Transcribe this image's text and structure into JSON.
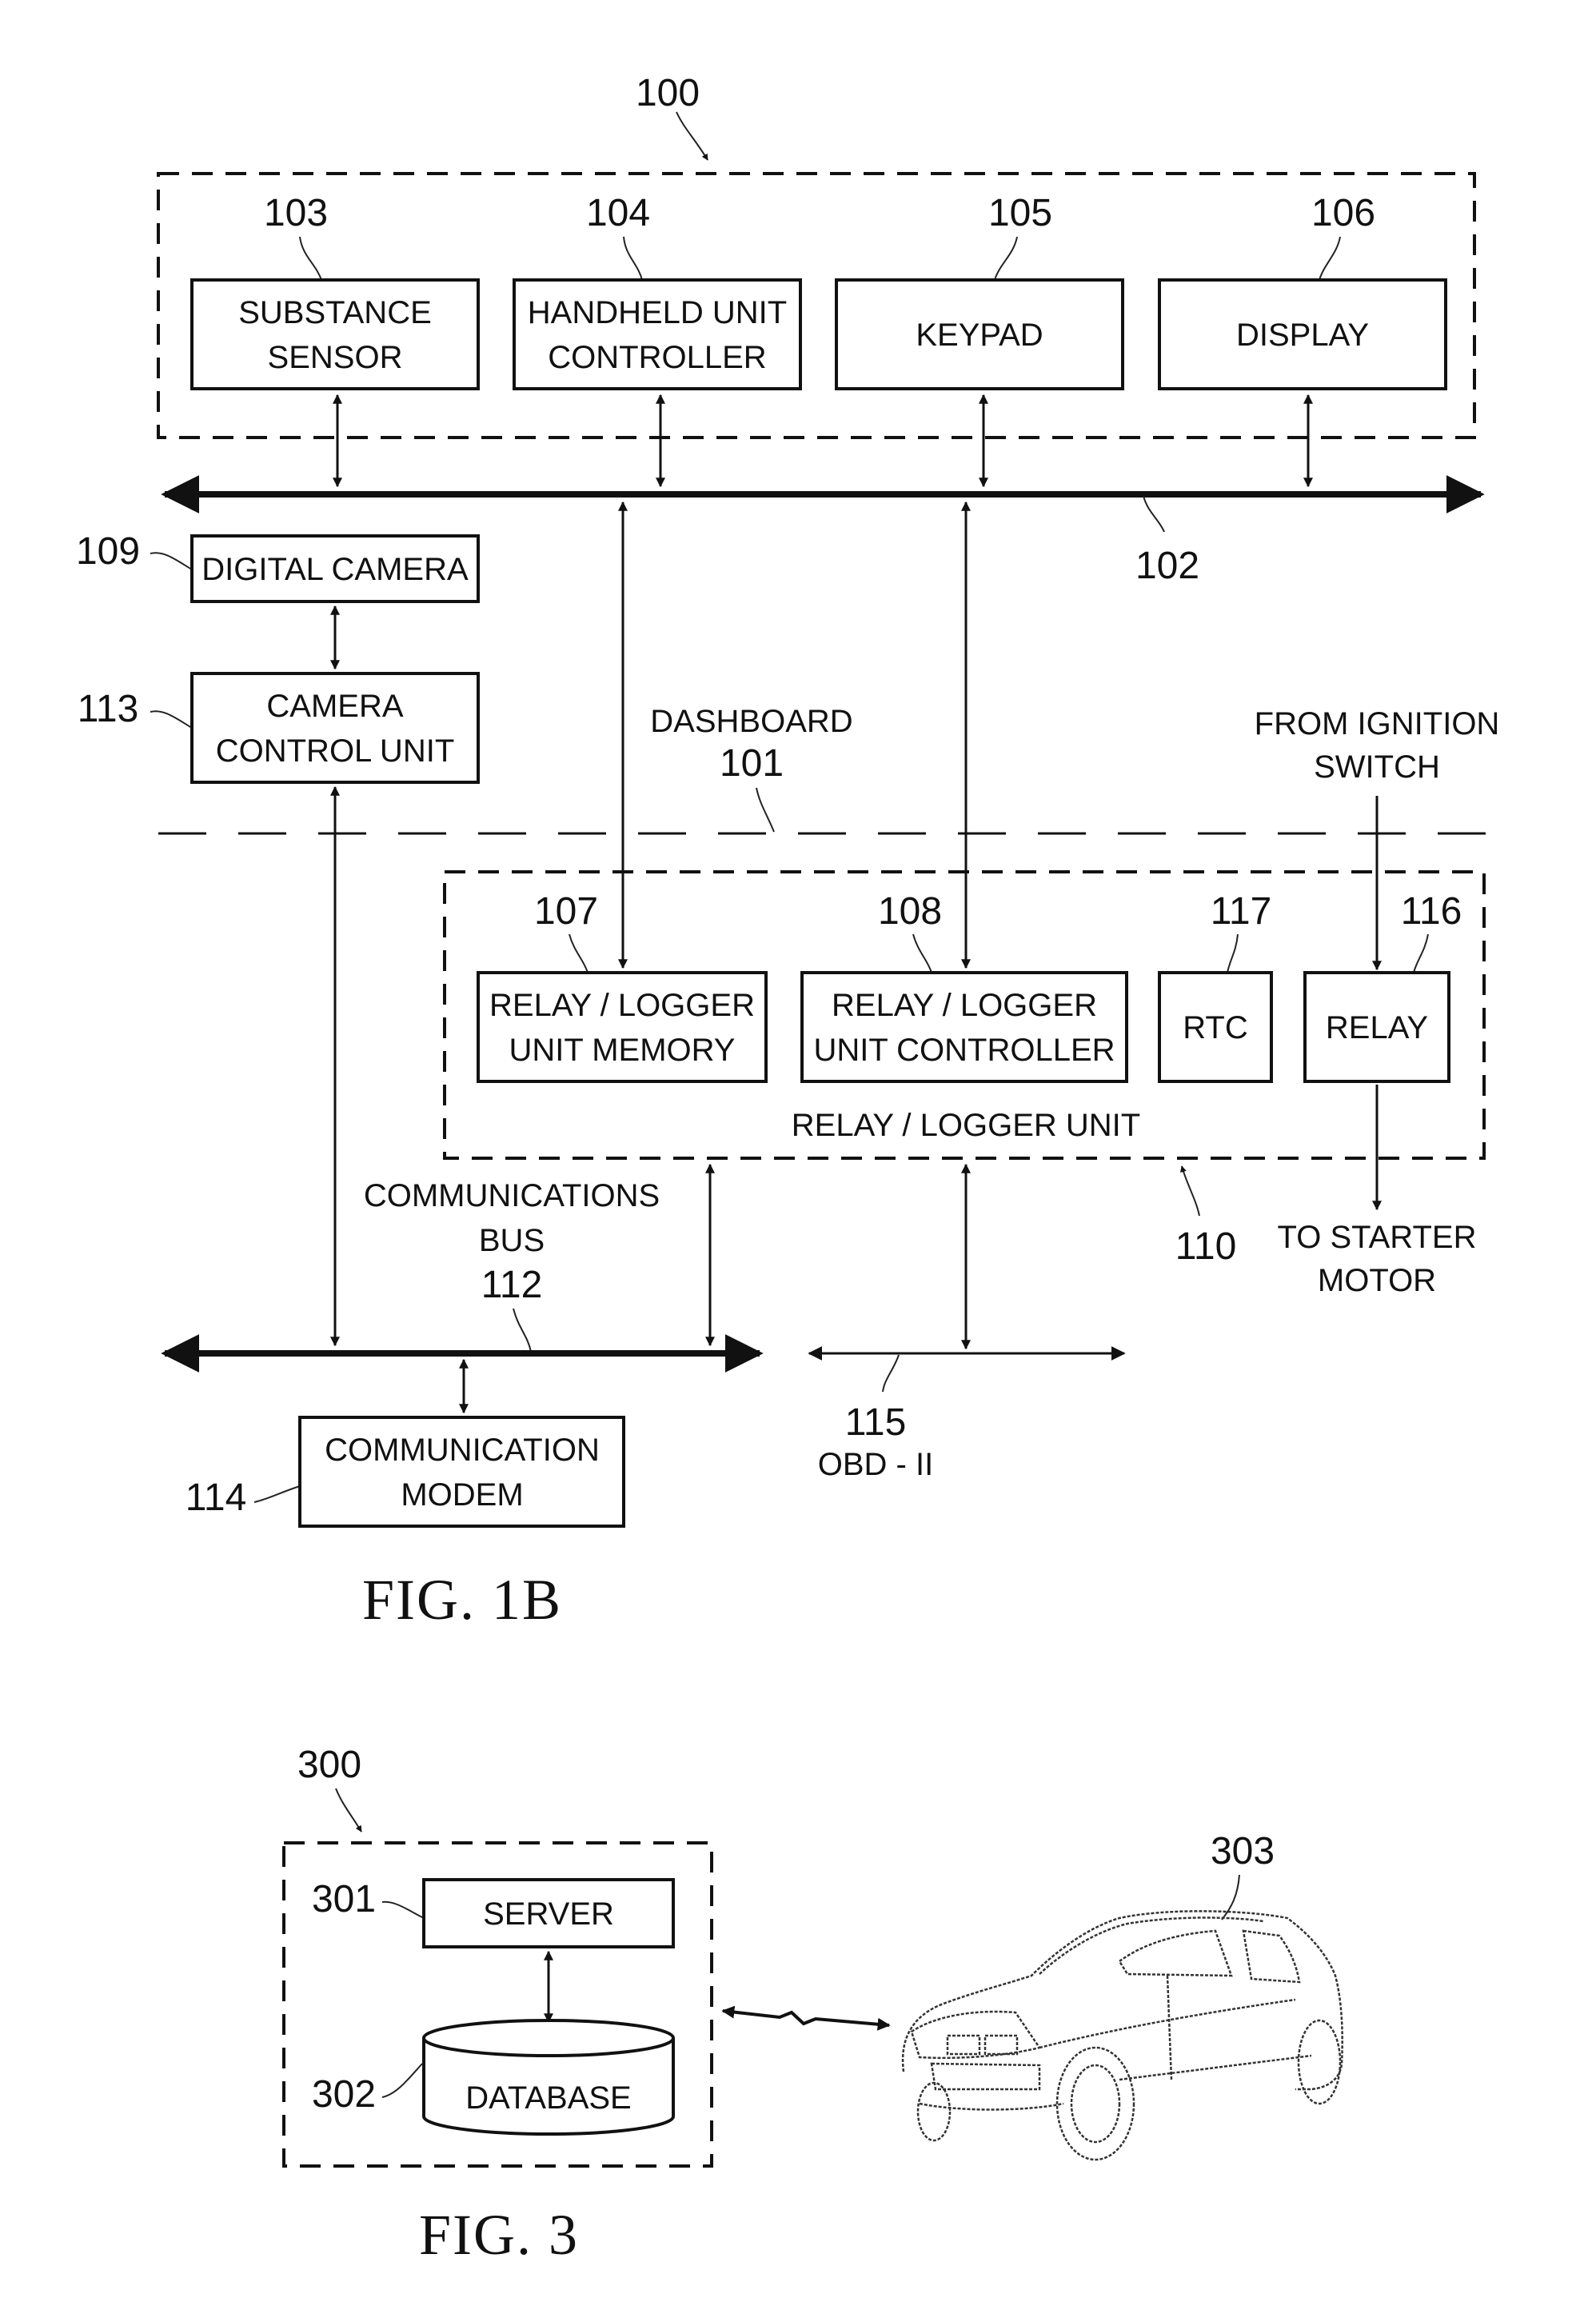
{
  "fig1b": {
    "title": "FIG. 1B",
    "handheld_unit": {
      "ref": "100"
    },
    "bus_102": {
      "ref": "102"
    },
    "dashboard": {
      "label": "DASHBOARD",
      "ref": "101"
    },
    "blocks": {
      "substance_sensor": {
        "ref": "103",
        "line1": "SUBSTANCE",
        "line2": "SENSOR"
      },
      "handheld_controller": {
        "ref": "104",
        "line1": "HANDHELD UNIT",
        "line2": "CONTROLLER"
      },
      "keypad": {
        "ref": "105",
        "line1": "KEYPAD"
      },
      "display": {
        "ref": "106",
        "line1": "DISPLAY"
      },
      "digital_camera": {
        "ref": "109",
        "line1": "DIGITAL CAMERA"
      },
      "camera_control": {
        "ref": "113",
        "line1": "CAMERA",
        "line2": "CONTROL UNIT"
      },
      "logger_memory": {
        "ref": "107",
        "line1": "RELAY / LOGGER",
        "line2": "UNIT MEMORY"
      },
      "logger_controller": {
        "ref": "108",
        "line1": "RELAY / LOGGER",
        "line2": "UNIT CONTROLLER"
      },
      "rtc": {
        "ref": "117",
        "line1": "RTC"
      },
      "relay": {
        "ref": "116",
        "line1": "RELAY"
      },
      "comm_modem": {
        "ref": "114",
        "line1": "COMMUNICATION",
        "line2": "MODEM"
      }
    },
    "relay_logger_unit": {
      "label": "RELAY / LOGGER UNIT",
      "ref": "110"
    },
    "ignition": {
      "line1": "FROM IGNITION",
      "line2": "SWITCH"
    },
    "starter": {
      "line1": "TO STARTER",
      "line2": "MOTOR"
    },
    "comm_bus": {
      "line1": "COMMUNICATIONS",
      "line2": "BUS",
      "ref": "112"
    },
    "obd": {
      "ref": "115",
      "label": "OBD - II"
    }
  },
  "fig3": {
    "title": "FIG. 3",
    "system": {
      "ref": "300"
    },
    "server": {
      "ref": "301",
      "label": "SERVER"
    },
    "database": {
      "ref": "302",
      "label": "DATABASE"
    },
    "vehicle": {
      "ref": "303"
    }
  }
}
